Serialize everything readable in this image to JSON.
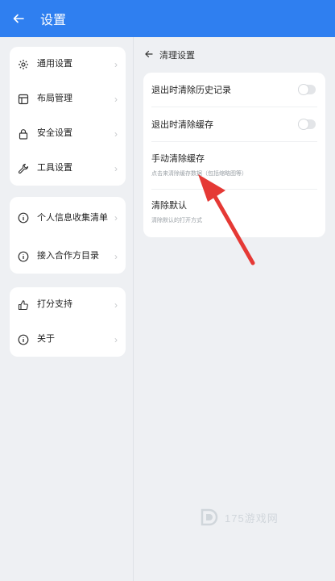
{
  "topbar": {
    "title": "设置",
    "back_icon": "arrow-left-icon",
    "bg_color": "#2f7ff0"
  },
  "left_menu": {
    "group1": [
      {
        "label": "通用设置",
        "icon": "gear-icon"
      },
      {
        "label": "布局管理",
        "icon": "layout-icon"
      },
      {
        "label": "安全设置",
        "icon": "lock-icon"
      },
      {
        "label": "工具设置",
        "icon": "wrench-icon"
      }
    ],
    "group2": [
      {
        "label": "个人信息收集清单",
        "icon": "info-circle-icon"
      },
      {
        "label": "接入合作方目录",
        "icon": "info-circle-icon"
      }
    ],
    "group3": [
      {
        "label": "打分支持",
        "icon": "thumbs-up-icon"
      },
      {
        "label": "关于",
        "icon": "info-circle-icon"
      }
    ]
  },
  "right_panel": {
    "header": "清理设置",
    "settings": [
      {
        "title": "退出时清除历史记录",
        "toggle": false
      },
      {
        "title": "退出时清除缓存",
        "toggle": false
      },
      {
        "title": "手动清除缓存",
        "subtitle": "点击来清除缓存数据（包括缩略图等）"
      },
      {
        "title": "清除默认",
        "subtitle": "清除默认的打开方式"
      }
    ]
  },
  "annotation": {
    "color": "#e53935"
  },
  "watermark": {
    "text": "175游戏网"
  }
}
